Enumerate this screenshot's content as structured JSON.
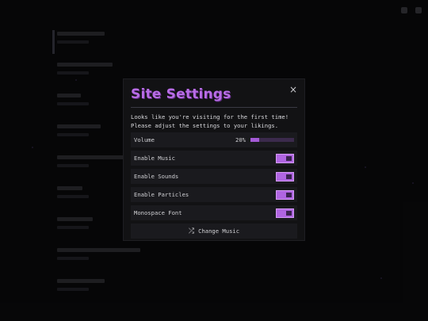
{
  "modal": {
    "title": "Site Settings",
    "close_glyph": "×",
    "intro_line1": "Looks like you're visiting for the first time!",
    "intro_line2": "Please adjust the settings to your likings.",
    "volume": {
      "label": "Volume",
      "value_text": "20%",
      "level": 0.2
    },
    "toggles": [
      {
        "label": "Enable Music",
        "on": true
      },
      {
        "label": "Enable Sounds",
        "on": true
      },
      {
        "label": "Enable Particles",
        "on": true
      },
      {
        "label": "Monospace Font",
        "on": true
      }
    ],
    "change_music": {
      "label": "Change Music",
      "icon": "shuffle-icon",
      "glyph": "⤮"
    }
  },
  "colors": {
    "accent": "#b065e2",
    "title": "#b86ce6",
    "panel": "#121214",
    "row": "#1a1a1e"
  }
}
